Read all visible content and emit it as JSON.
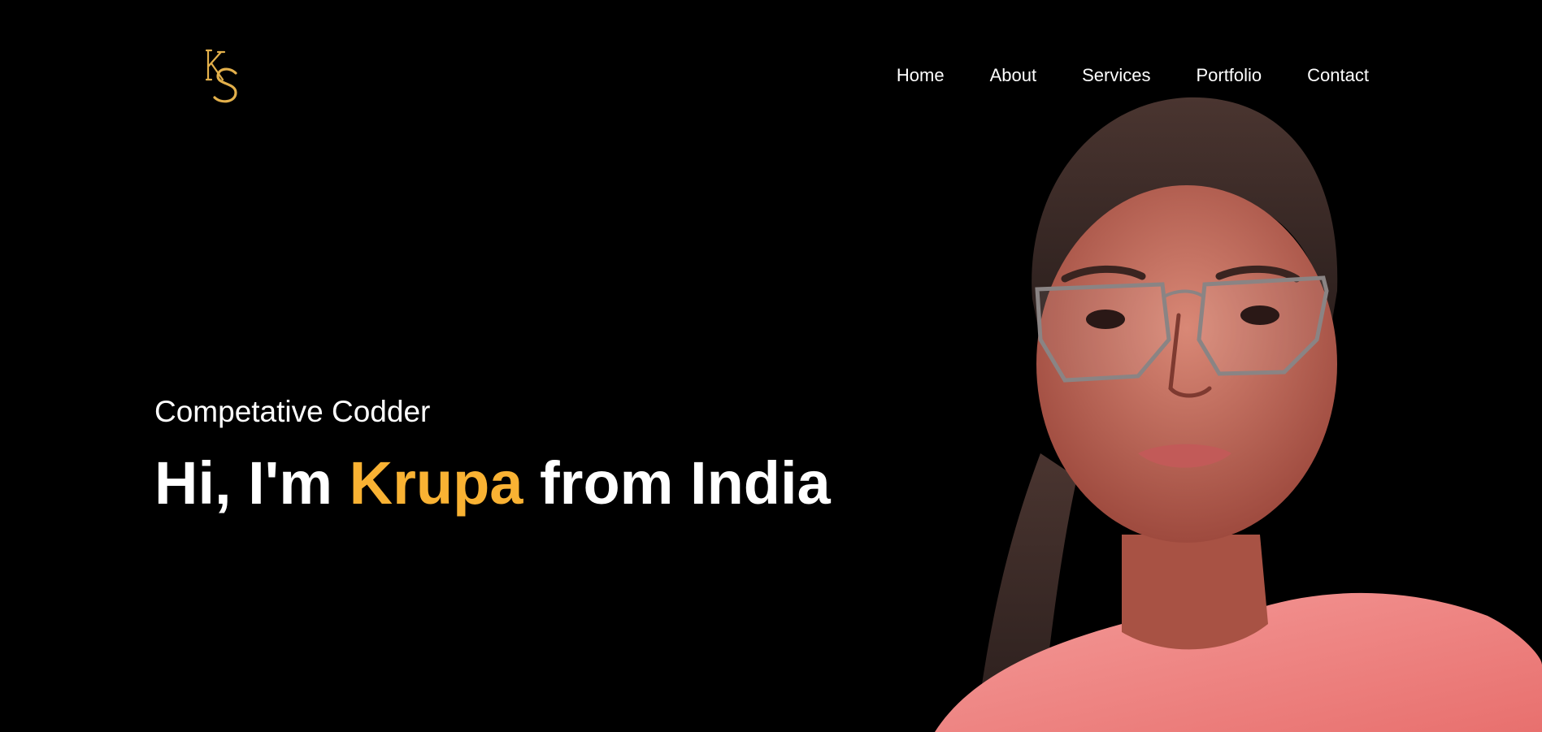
{
  "logo": {
    "letters": "KS",
    "color": "#e3b04b"
  },
  "nav": {
    "items": [
      {
        "label": "Home"
      },
      {
        "label": "About"
      },
      {
        "label": "Services"
      },
      {
        "label": "Portfolio"
      },
      {
        "label": "Contact"
      }
    ]
  },
  "hero": {
    "subtitle": "Competative Codder",
    "headline_prefix": "Hi, I'm ",
    "headline_name": "Krupa",
    "headline_suffix": " from India",
    "accent_color": "#f9b233"
  },
  "portrait": {
    "shirt_color": "#f08a8a",
    "skin_color": "#c46a5a",
    "hair_color": "#3a2a28"
  }
}
